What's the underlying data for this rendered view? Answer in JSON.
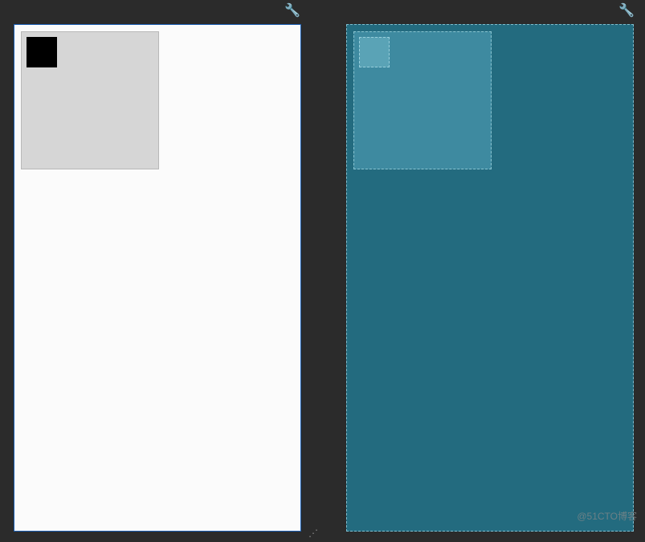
{
  "toolbar": {
    "wrench_left": "🔧",
    "wrench_right": "🔧"
  },
  "panes": {
    "left": {
      "bg_color": "#fbfbfb",
      "mid_color": "#d6d6d6",
      "inner_color": "#000000"
    },
    "right": {
      "bg_color": "#236b7f",
      "mid_color": "#3e8aa0",
      "inner_color": "#5aa3b6"
    }
  },
  "watermark": "@51CTO博客"
}
